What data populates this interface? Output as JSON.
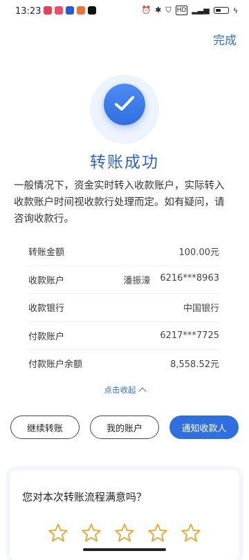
{
  "status_bar": {
    "time": "13:23",
    "app_icon_colors": [
      "#e83f5b",
      "#f24a6b",
      "#2a5bd7",
      "#f2713a",
      "#111111"
    ],
    "system_icons": [
      "alarm-icon",
      "bluetooth-icon",
      "vpn-icon",
      "hd-icon",
      "signal-icon",
      "battery-icon"
    ]
  },
  "header": {
    "done_label": "完成"
  },
  "result": {
    "title": "转账成功",
    "notice": "一般情况下，资金实时转入收款账户，实际转入收款账户时间视收款行处理而定。如有疑问，请咨询收款行。"
  },
  "details": [
    {
      "label": "转账金额",
      "value": "100.00元",
      "name": ""
    },
    {
      "label": "收款账户",
      "value": "6216***8963",
      "name": "潘振濠"
    },
    {
      "label": "收款银行",
      "value": "中国银行",
      "name": ""
    },
    {
      "label": "付款账户",
      "value": "6217***7725",
      "name": ""
    },
    {
      "label": "付款账户余额",
      "value": "8,558.52元",
      "name": ""
    }
  ],
  "collapse_label": "点击收起",
  "actions": {
    "continue_label": "继续转账",
    "my_account_label": "我的账户",
    "notify_label": "通知收款人"
  },
  "survey": {
    "question": "您对本次转账流程满意吗？",
    "star_count": 5,
    "star_color": "#e9a93a"
  },
  "colors": {
    "accent": "#2f6fe0",
    "title": "#2e63c5"
  }
}
